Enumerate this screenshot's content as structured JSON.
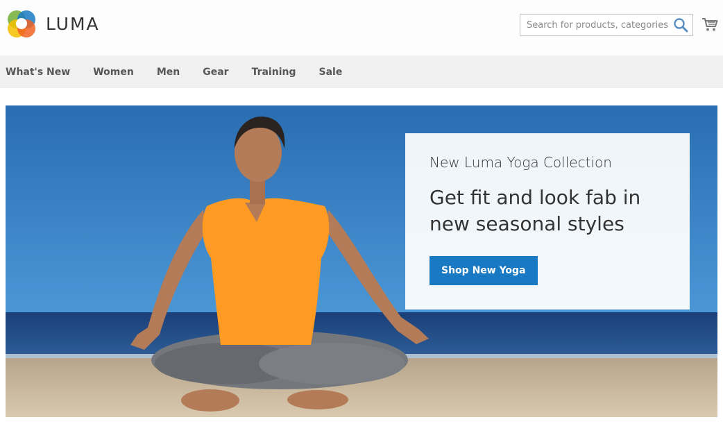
{
  "brand": {
    "name": "LUMA",
    "logo_colors": [
      "#f26322",
      "#1979c3",
      "#7ab142",
      "#f5c000"
    ]
  },
  "search": {
    "placeholder": "Search for products, categories, ...",
    "icon": "search-icon"
  },
  "cart": {
    "icon": "cart-icon"
  },
  "nav": {
    "items": [
      {
        "label": "What's New"
      },
      {
        "label": "Women"
      },
      {
        "label": "Men"
      },
      {
        "label": "Gear"
      },
      {
        "label": "Training"
      },
      {
        "label": "Sale"
      }
    ]
  },
  "hero": {
    "subtitle": "New Luma Yoga Collection",
    "title_line1": "Get fit and look fab in",
    "title_line2": "new seasonal styles",
    "cta_label": "Shop New Yoga",
    "colors": {
      "sky": "#2d77b8",
      "sea": "#1f4e87",
      "sand": "#c9b79c",
      "shirt": "#ff9a22",
      "cta": "#1979c3"
    }
  }
}
